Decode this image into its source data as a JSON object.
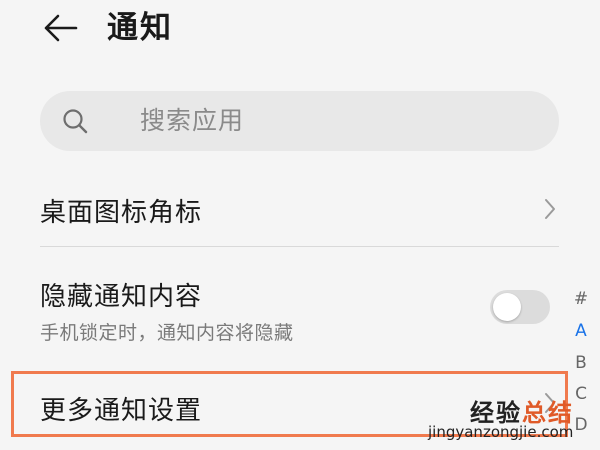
{
  "header": {
    "back_icon": "arrow-left-icon",
    "title": "通知"
  },
  "search": {
    "icon": "search-icon",
    "placeholder": "搜索应用"
  },
  "settings": {
    "badge_row": {
      "label": "桌面图标角标",
      "icon": "chevron-right-icon"
    },
    "hide_content_row": {
      "label": "隐藏通知内容",
      "description": "手机锁定时，通知内容将隐藏",
      "toggle_on": false
    },
    "more_settings_row": {
      "label": "更多通知设置",
      "icon": "chevron-right-icon"
    }
  },
  "index_bar": {
    "letters": [
      "#",
      "A",
      "B",
      "C",
      "D"
    ],
    "active": "A"
  },
  "watermark": {
    "title_part1": "经验",
    "title_part2": "总结",
    "url": "jingyanzongjie.com"
  },
  "colors": {
    "background": "#f5f5f5",
    "search_bg": "#e8e8e8",
    "accent_blue": "#1a73e8",
    "highlight_orange": "#f07a4e",
    "toggle_off": "#dcdcdc"
  }
}
